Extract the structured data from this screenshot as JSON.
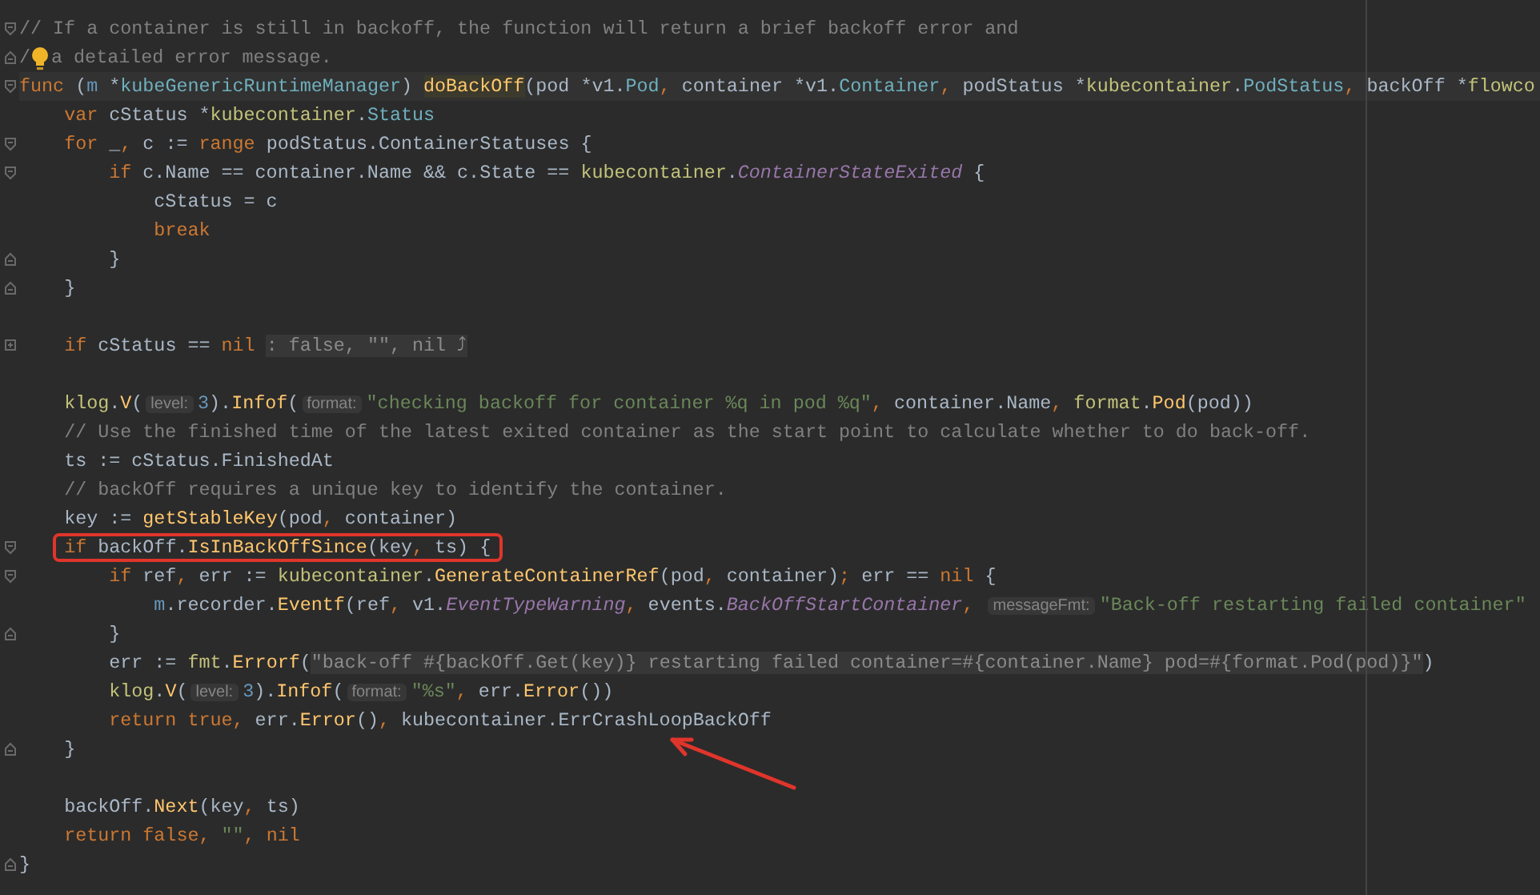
{
  "editor": {
    "lines": [
      {
        "fold": {
          "kind": "open"
        },
        "tokens": [
          {
            "text": "// If a container is still in backoff, the function will return a brief backoff error and",
            "kind": "comment"
          }
        ]
      },
      {
        "fold": {
          "kind": "close"
        },
        "bulb": true,
        "tokens": [
          {
            "text": "/",
            "kind": "comment"
          },
          {
            "text": "a detailed error message.",
            "kind": "comment"
          }
        ]
      },
      {
        "fold": {
          "kind": "open"
        },
        "current": true,
        "tokens": [
          {
            "text": "func",
            "kind": "keyword"
          },
          {
            "text": " (",
            "kind": "plain"
          },
          {
            "text": "m",
            "kind": "receiver"
          },
          {
            "text": " *",
            "kind": "plain"
          },
          {
            "text": "kubeGenericRuntimeManager",
            "kind": "type"
          },
          {
            "text": ") ",
            "kind": "plain"
          },
          {
            "text": "doBackOff",
            "kind": "declaration"
          },
          {
            "text": "(pod *",
            "kind": "plain"
          },
          {
            "text": "v1",
            "kind": "plain"
          },
          {
            "text": ".",
            "kind": "plain"
          },
          {
            "text": "Pod",
            "kind": "type"
          },
          {
            "text": ",",
            "kind": "punct"
          },
          {
            "text": " container *v1.",
            "kind": "plain"
          },
          {
            "text": "Container",
            "kind": "type"
          },
          {
            "text": ",",
            "kind": "punct"
          },
          {
            "text": " podStatus *",
            "kind": "plain"
          },
          {
            "text": "kubecontainer",
            "kind": "package"
          },
          {
            "text": ".",
            "kind": "plain"
          },
          {
            "text": "PodStatus",
            "kind": "type"
          },
          {
            "text": ",",
            "kind": "punct"
          },
          {
            "text": " backOff *",
            "kind": "plain"
          },
          {
            "text": "flowco",
            "kind": "package"
          }
        ]
      },
      {
        "tokens": [
          {
            "text": "    var",
            "kind": "keyword"
          },
          {
            "text": " cStatus *",
            "kind": "plain"
          },
          {
            "text": "kubecontainer",
            "kind": "package"
          },
          {
            "text": ".",
            "kind": "plain"
          },
          {
            "text": "Status",
            "kind": "type"
          }
        ]
      },
      {
        "fold": {
          "kind": "open"
        },
        "tokens": [
          {
            "text": "    for",
            "kind": "keyword"
          },
          {
            "text": " _",
            "kind": "plain"
          },
          {
            "text": ",",
            "kind": "punct"
          },
          {
            "text": " c := ",
            "kind": "plain"
          },
          {
            "text": "range",
            "kind": "keyword"
          },
          {
            "text": " podStatus.ContainerStatuses {",
            "kind": "plain"
          }
        ]
      },
      {
        "fold": {
          "kind": "open"
        },
        "tokens": [
          {
            "text": "        if",
            "kind": "keyword"
          },
          {
            "text": " c.Name == container.Name && c.State == ",
            "kind": "plain"
          },
          {
            "text": "kubecontainer",
            "kind": "package"
          },
          {
            "text": ".",
            "kind": "plain"
          },
          {
            "text": "ContainerStateExited",
            "kind": "constant"
          },
          {
            "text": " {",
            "kind": "plain"
          }
        ]
      },
      {
        "tokens": [
          {
            "text": "            cStatus = c",
            "kind": "plain"
          }
        ]
      },
      {
        "tokens": [
          {
            "text": "            break",
            "kind": "keyword"
          }
        ]
      },
      {
        "fold": {
          "kind": "close"
        },
        "tokens": [
          {
            "text": "        }",
            "kind": "plain"
          }
        ]
      },
      {
        "fold": {
          "kind": "close"
        },
        "tokens": [
          {
            "text": "    }",
            "kind": "plain"
          }
        ]
      },
      {
        "kind": "blank"
      },
      {
        "fold": {
          "kind": "collapsed"
        },
        "tokens": [
          {
            "text": "    if",
            "kind": "keyword"
          },
          {
            "text": " cStatus == ",
            "kind": "plain"
          },
          {
            "text": "nil ",
            "kind": "keyword"
          },
          {
            "text": ": false, \"\", nil ⤴",
            "kind": "folded"
          }
        ]
      },
      {
        "kind": "blank"
      },
      {
        "tokens": [
          {
            "text": "    klog",
            "kind": "package"
          },
          {
            "text": ".",
            "kind": "plain"
          },
          {
            "text": "V",
            "kind": "function"
          },
          {
            "text": "(",
            "kind": "plain"
          },
          {
            "text": "level:",
            "kind": "hint"
          },
          {
            "text": "3",
            "kind": "number"
          },
          {
            "text": ").",
            "kind": "plain"
          },
          {
            "text": "Infof",
            "kind": "function"
          },
          {
            "text": "(",
            "kind": "plain"
          },
          {
            "text": "format:",
            "kind": "hint"
          },
          {
            "text": "\"checking backoff for container %q in pod %q\"",
            "kind": "string"
          },
          {
            "text": ",",
            "kind": "punct"
          },
          {
            "text": " container.Name",
            "kind": "plain"
          },
          {
            "text": ",",
            "kind": "punct"
          },
          {
            "text": " format",
            "kind": "package"
          },
          {
            "text": ".",
            "kind": "plain"
          },
          {
            "text": "Pod",
            "kind": "function"
          },
          {
            "text": "(pod))",
            "kind": "plain"
          }
        ]
      },
      {
        "tokens": [
          {
            "text": "    // Use the finished time of the latest exited container as the start point to calculate whether to do back-off.",
            "kind": "comment"
          }
        ]
      },
      {
        "tokens": [
          {
            "text": "    ts := cStatus.FinishedAt",
            "kind": "plain"
          }
        ]
      },
      {
        "tokens": [
          {
            "text": "    // backOff requires a unique key to identify the container.",
            "kind": "comment"
          }
        ]
      },
      {
        "tokens": [
          {
            "text": "    key := ",
            "kind": "plain"
          },
          {
            "text": "getStableKey",
            "kind": "function"
          },
          {
            "text": "(pod",
            "kind": "plain"
          },
          {
            "text": ",",
            "kind": "punct"
          },
          {
            "text": " container)",
            "kind": "plain"
          }
        ]
      },
      {
        "fold": {
          "kind": "open"
        },
        "boxed": true,
        "tokens": [
          {
            "text": "    if",
            "kind": "keyword"
          },
          {
            "text": " backOff.",
            "kind": "plain"
          },
          {
            "text": "IsInBackOffSince",
            "kind": "function"
          },
          {
            "text": "(key",
            "kind": "plain"
          },
          {
            "text": ",",
            "kind": "punct"
          },
          {
            "text": " ts) {",
            "kind": "plain"
          }
        ]
      },
      {
        "fold": {
          "kind": "open"
        },
        "tokens": [
          {
            "text": "        if",
            "kind": "keyword"
          },
          {
            "text": " ref",
            "kind": "plain"
          },
          {
            "text": ",",
            "kind": "punct"
          },
          {
            "text": " err := ",
            "kind": "plain"
          },
          {
            "text": "kubecontainer",
            "kind": "package"
          },
          {
            "text": ".",
            "kind": "plain"
          },
          {
            "text": "GenerateContainerRef",
            "kind": "function"
          },
          {
            "text": "(pod",
            "kind": "plain"
          },
          {
            "text": ",",
            "kind": "punct"
          },
          {
            "text": " container)",
            "kind": "plain"
          },
          {
            "text": ";",
            "kind": "punct"
          },
          {
            "text": " err == ",
            "kind": "plain"
          },
          {
            "text": "nil",
            "kind": "keyword"
          },
          {
            "text": " {",
            "kind": "plain"
          }
        ]
      },
      {
        "tokens": [
          {
            "text": "            m",
            "kind": "receiver"
          },
          {
            "text": ".recorder.",
            "kind": "plain"
          },
          {
            "text": "Eventf",
            "kind": "function"
          },
          {
            "text": "(ref",
            "kind": "plain"
          },
          {
            "text": ",",
            "kind": "punct"
          },
          {
            "text": " v1.",
            "kind": "plain"
          },
          {
            "text": "EventTypeWarning",
            "kind": "constant"
          },
          {
            "text": ",",
            "kind": "punct"
          },
          {
            "text": " events.",
            "kind": "plain"
          },
          {
            "text": "BackOffStartContainer",
            "kind": "constant"
          },
          {
            "text": ", ",
            "kind": "punct"
          },
          {
            "text": "messageFmt:",
            "kind": "hint"
          },
          {
            "text": "\"Back-off restarting failed container\"",
            "kind": "string"
          }
        ]
      },
      {
        "fold": {
          "kind": "close"
        },
        "tokens": [
          {
            "text": "        }",
            "kind": "plain"
          }
        ]
      },
      {
        "tokens": [
          {
            "text": "        err := ",
            "kind": "plain"
          },
          {
            "text": "fmt",
            "kind": "package"
          },
          {
            "text": ".",
            "kind": "plain"
          },
          {
            "text": "Errorf",
            "kind": "function"
          },
          {
            "text": "(",
            "kind": "plain"
          },
          {
            "text": "\"back-off #{backOff.Get(key)} restarting failed container=#{container.Name} pod=#{format.Pod(pod)}\"",
            "kind": "folded"
          },
          {
            "text": ")",
            "kind": "plain"
          }
        ]
      },
      {
        "tokens": [
          {
            "text": "        klog",
            "kind": "package"
          },
          {
            "text": ".",
            "kind": "plain"
          },
          {
            "text": "V",
            "kind": "function"
          },
          {
            "text": "(",
            "kind": "plain"
          },
          {
            "text": "level:",
            "kind": "hint"
          },
          {
            "text": "3",
            "kind": "number"
          },
          {
            "text": ").",
            "kind": "plain"
          },
          {
            "text": "Infof",
            "kind": "function"
          },
          {
            "text": "(",
            "kind": "plain"
          },
          {
            "text": "format:",
            "kind": "hint"
          },
          {
            "text": "\"%s\"",
            "kind": "string"
          },
          {
            "text": ",",
            "kind": "punct"
          },
          {
            "text": " err.",
            "kind": "plain"
          },
          {
            "text": "Error",
            "kind": "function"
          },
          {
            "text": "())",
            "kind": "plain"
          }
        ]
      },
      {
        "tokens": [
          {
            "text": "        return true",
            "kind": "keyword"
          },
          {
            "text": ",",
            "kind": "punct"
          },
          {
            "text": " err.",
            "kind": "plain"
          },
          {
            "text": "Error",
            "kind": "function"
          },
          {
            "text": "()",
            "kind": "plain"
          },
          {
            "text": ",",
            "kind": "punct"
          },
          {
            "text": " kubecontainer.ErrCrashLoopBackOff",
            "kind": "plain"
          }
        ]
      },
      {
        "fold": {
          "kind": "close"
        },
        "tokens": [
          {
            "text": "    }",
            "kind": "plain"
          }
        ]
      },
      {
        "kind": "blank"
      },
      {
        "tokens": [
          {
            "text": "    backOff.",
            "kind": "plain"
          },
          {
            "text": "Next",
            "kind": "function"
          },
          {
            "text": "(key",
            "kind": "plain"
          },
          {
            "text": ",",
            "kind": "punct"
          },
          {
            "text": " ts)",
            "kind": "plain"
          }
        ]
      },
      {
        "tokens": [
          {
            "text": "    return false",
            "kind": "keyword"
          },
          {
            "text": ",",
            "kind": "punct"
          },
          {
            "text": " \"\"",
            "kind": "string"
          },
          {
            "text": ",",
            "kind": "punct"
          },
          {
            "text": " nil",
            "kind": "keyword"
          }
        ]
      },
      {
        "fold": {
          "kind": "close"
        },
        "tokens": [
          {
            "text": "}",
            "kind": "plain"
          }
        ]
      }
    ]
  }
}
